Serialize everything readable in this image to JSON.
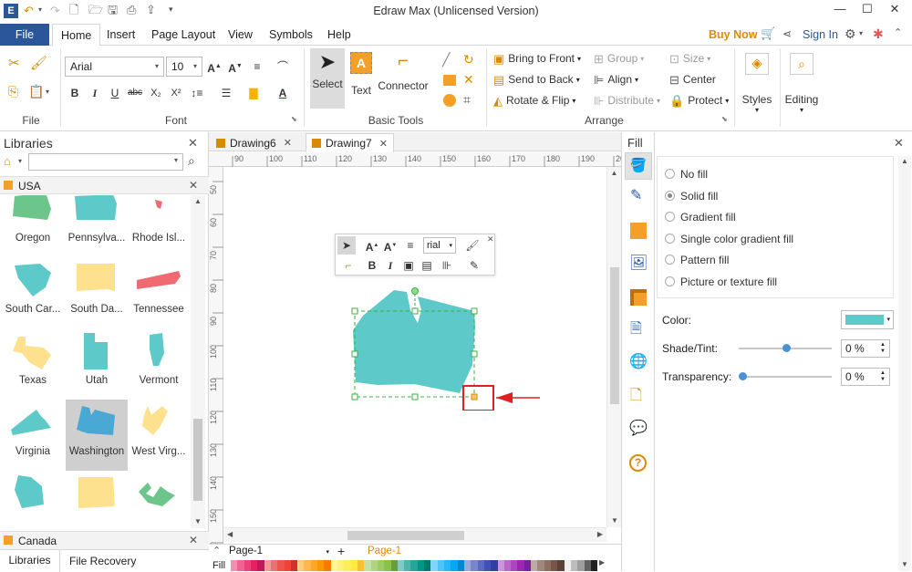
{
  "app": {
    "title": "Edraw Max (Unlicensed Version)"
  },
  "menu_tabs": [
    "File",
    "Home",
    "Insert",
    "Page Layout",
    "View",
    "Symbols",
    "Help"
  ],
  "account": {
    "buy_now": "Buy Now",
    "sign_in": "Sign In"
  },
  "ribbon": {
    "font_name": "Arial",
    "font_size": "10",
    "groups": {
      "file": "File",
      "font": "Font",
      "basic_tools": "Basic Tools",
      "arrange": "Arrange"
    },
    "tools": {
      "select": "Select",
      "text": "Text",
      "connector": "Connector"
    },
    "arrange": {
      "bring_to_front": "Bring to Front",
      "send_to_back": "Send to Back",
      "rotate_flip": "Rotate & Flip",
      "group": "Group",
      "align": "Align",
      "distribute": "Distribute",
      "size": "Size",
      "center": "Center",
      "protect": "Protect"
    },
    "styles": "Styles",
    "editing": "Editing"
  },
  "libraries": {
    "title": "Libraries",
    "search_placeholder": "",
    "category": "USA",
    "shapes": [
      {
        "label": "Oregon",
        "color": "#6cc58a"
      },
      {
        "label": "Pennsylva...",
        "color": "#5ec9c9"
      },
      {
        "label": "Rhode Isl...",
        "color": "#f06a72"
      },
      {
        "label": "South Car...",
        "color": "#5ec9c9"
      },
      {
        "label": "South Da...",
        "color": "#fde18f"
      },
      {
        "label": "Tennessee",
        "color": "#f06a72"
      },
      {
        "label": "Texas",
        "color": "#fde18f"
      },
      {
        "label": "Utah",
        "color": "#5ec9c9"
      },
      {
        "label": "Vermont",
        "color": "#5ec9c9"
      },
      {
        "label": "Virginia",
        "color": "#5ec9c9"
      },
      {
        "label": "Washington",
        "color": "#4aa8d4"
      },
      {
        "label": "West Virg...",
        "color": "#fde18f"
      },
      {
        "label": "",
        "color": "#5ec9c9"
      },
      {
        "label": "",
        "color": "#fde18f"
      },
      {
        "label": "",
        "color": "#6cc58a"
      }
    ],
    "next_category": "Canada",
    "bottom_tabs": [
      "Libraries",
      "File Recovery"
    ]
  },
  "documents": {
    "tabs": [
      "Drawing6",
      "Drawing7"
    ]
  },
  "rulers": {
    "horizontal": [
      "90",
      "100",
      "110",
      "120",
      "130",
      "140",
      "150",
      "160",
      "170",
      "180",
      "190",
      "200"
    ],
    "vertical": [
      "50",
      "60",
      "70",
      "80",
      "90",
      "100",
      "110",
      "120",
      "130",
      "140",
      "150",
      "160"
    ]
  },
  "floating_toolbar": {
    "font": "rial"
  },
  "pages": {
    "selector": "Page-1",
    "active_tab": "Page-1",
    "fill_label": "Fill"
  },
  "fill_panel": {
    "title": "Fill",
    "options": [
      "No fill",
      "Solid fill",
      "Gradient fill",
      "Single color gradient fill",
      "Pattern fill",
      "Picture or texture fill"
    ],
    "selected": "Solid fill",
    "color_label": "Color:",
    "color_value": "#5ec9c9",
    "shade_label": "Shade/Tint:",
    "shade_value": "0 %",
    "transparency_label": "Transparency:",
    "transparency_value": "0 %"
  },
  "palette": [
    "#f48fb1",
    "#f06292",
    "#ec407a",
    "#e91e63",
    "#c2185b",
    "#ef9a9a",
    "#e57373",
    "#ef5350",
    "#f44336",
    "#d32f2f",
    "#ffcc80",
    "#ffb74d",
    "#ffa726",
    "#ff9800",
    "#f57c00",
    "#fff59d",
    "#fff176",
    "#ffee58",
    "#ffeb3b",
    "#fbc02d",
    "#c5e1a5",
    "#aed581",
    "#9ccc65",
    "#8bc34a",
    "#689f38",
    "#80cbc4",
    "#4db6ac",
    "#26a69a",
    "#009688",
    "#00796b",
    "#81d4fa",
    "#4fc3f7",
    "#29b6f6",
    "#03a9f4",
    "#0288d1",
    "#9fa8da",
    "#7986cb",
    "#5c6bc0",
    "#3f51b5",
    "#303f9f",
    "#ce93d8",
    "#ba68c8",
    "#ab47bc",
    "#9c27b0",
    "#7b1fa2",
    "#bcaaa4",
    "#a1887f",
    "#8d6e63",
    "#795548",
    "#5d4037",
    "#eeeeee",
    "#bdbdbd",
    "#9e9e9e",
    "#616161",
    "#212121"
  ]
}
